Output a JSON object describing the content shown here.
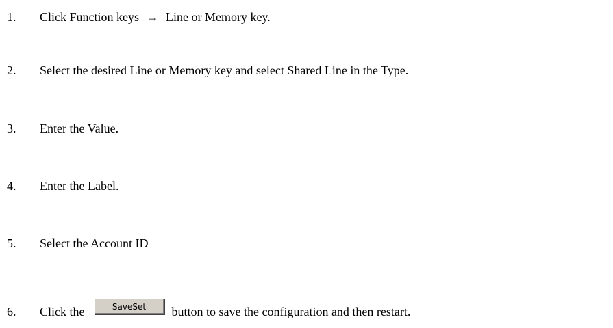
{
  "steps": [
    {
      "number": "1.",
      "text_before": "Click Function keys",
      "arrow": "→",
      "text_after": "Line or Memory key."
    },
    {
      "number": "2.",
      "text": "Select the desired Line or Memory key and select Shared Line in the Type."
    },
    {
      "number": "3.",
      "text": "Enter the Value."
    },
    {
      "number": "4.",
      "text": "Enter the Label."
    },
    {
      "number": "5.",
      "text": "Select the Account ID"
    },
    {
      "number": "6.",
      "text_before": "Click the",
      "button_label": "SaveSet",
      "text_after": "button to save the configuration and then restart."
    }
  ]
}
